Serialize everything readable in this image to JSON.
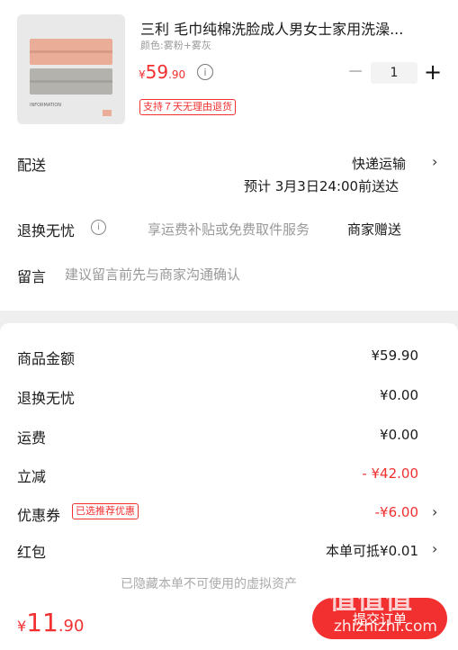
{
  "product": {
    "title": "三利 毛巾纯棉洗脸成人男女士家用洗澡...",
    "spec": "颜色:雾粉+雾灰",
    "price_yen": "¥",
    "price_int": "59",
    "price_dec": ".90",
    "quantity": "1",
    "minus_label": "−",
    "plus_label": "+",
    "return_badge": "支持７天无理由退货",
    "thumb_text": "INFORMATION"
  },
  "delivery": {
    "label": "配送",
    "method": "快递运输",
    "estimate": "预计 3月3日24:00前送达"
  },
  "worry_free": {
    "label": "退换无忧",
    "desc": "享运费补贴或免费取件服务",
    "gift": "商家赠送"
  },
  "message": {
    "label": "留言",
    "placeholder": "建议留言前先与商家沟通确认"
  },
  "summary": {
    "rows": [
      {
        "label": "商品金额",
        "value": "¥59.90"
      },
      {
        "label": "退换无忧",
        "value": "¥0.00"
      },
      {
        "label": "运费",
        "value": "¥0.00"
      },
      {
        "label": "立减",
        "value": "- ¥42.00"
      },
      {
        "label": "优惠券",
        "value": "-¥6.00"
      },
      {
        "label": "红包",
        "value": "本单可抵¥0.01"
      }
    ],
    "coupon_badge": "已选推荐优惠",
    "hidden_note": "已隐藏本单不可使用的虚拟资产"
  },
  "bottom": {
    "total_yen": "¥",
    "total_int": "11",
    "total_dec": ".90",
    "submit_label": "提交订单"
  },
  "watermark": {
    "logo": "值值值",
    "url": "zhizhizhi.com"
  },
  "colors": {
    "accent": "#f23030",
    "page_bg": "#efefef"
  }
}
